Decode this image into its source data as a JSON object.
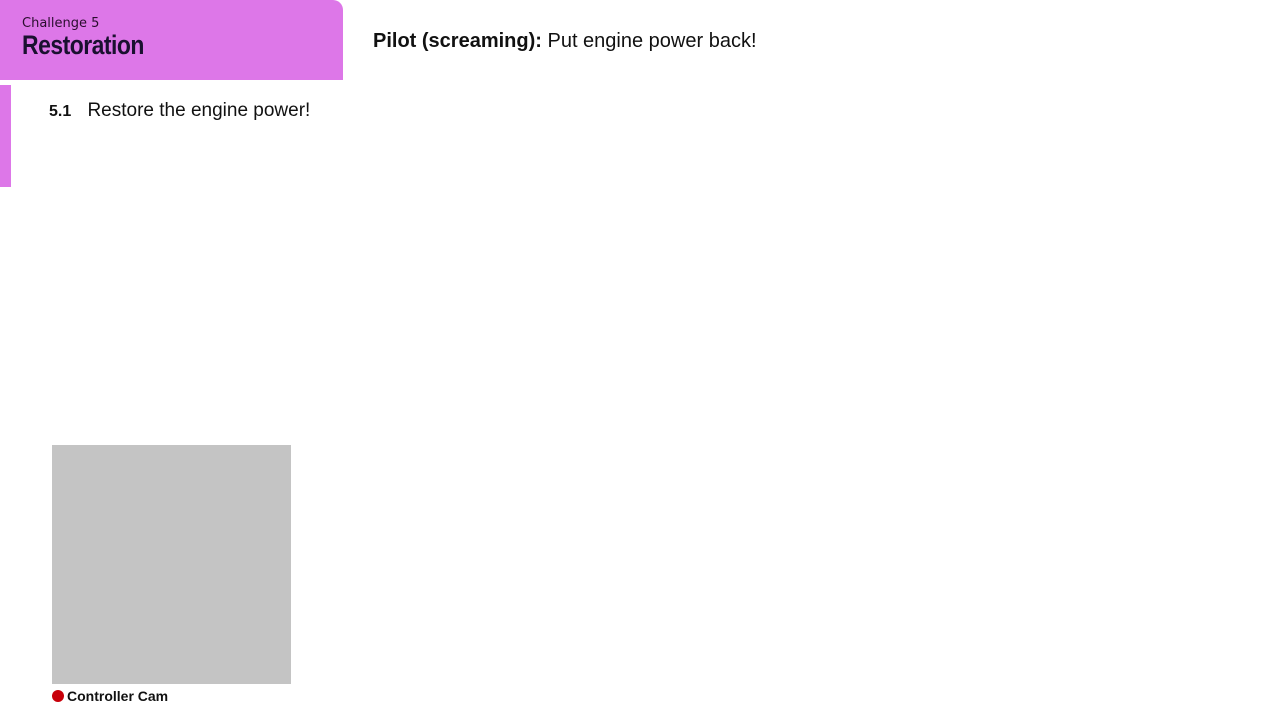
{
  "challenge": {
    "kicker": "Challenge 5",
    "title": "Restoration",
    "accent_color": "#dd77e8"
  },
  "dialog": {
    "speaker": "Pilot (screaming):",
    "line": "Put engine power back!"
  },
  "tasks": [
    {
      "number": "5.1",
      "text": "Restore the engine power!"
    }
  ],
  "camera": {
    "label": "Controller Cam",
    "indicator_icon": "record-dot-icon",
    "indicator_color": "#c8000a"
  }
}
